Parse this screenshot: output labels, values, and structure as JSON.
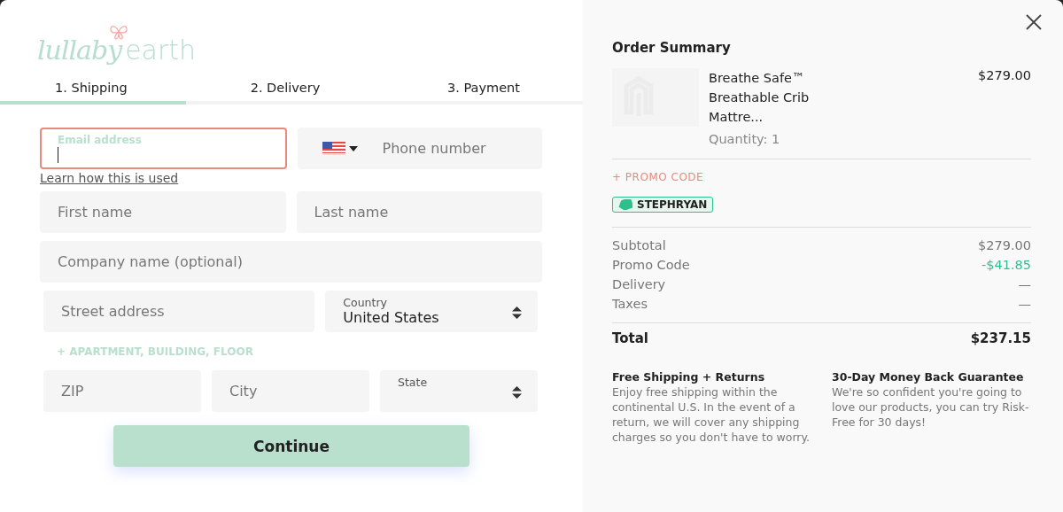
{
  "logo": {
    "text_1": "lullaby",
    "text_2": "earth"
  },
  "steps": [
    {
      "label": "1. Shipping",
      "selected": true
    },
    {
      "label": "2. Delivery",
      "selected": false
    },
    {
      "label": "3. Payment",
      "selected": false
    }
  ],
  "form": {
    "rows": [
      [
        {
          "kind": "input",
          "label": "Email address",
          "error": true,
          "focused": true
        },
        {
          "kind": "phone",
          "placeholder": "Phone number"
        }
      ],
      [
        {
          "kind": "link",
          "text": "Learn how this is used"
        }
      ],
      [
        {
          "kind": "input",
          "placeholder": "First name"
        },
        {
          "kind": "input",
          "placeholder": "Last name"
        }
      ],
      [
        {
          "kind": "input",
          "placeholder": "Company name (optional)"
        }
      ],
      [
        {
          "kind": "input",
          "placeholder": "Street address"
        },
        {
          "kind": "select",
          "label": "Country",
          "value": "United States"
        }
      ],
      [
        {
          "kind": "addlink",
          "text": "+ APARTMENT, BUILDING, FLOOR"
        }
      ],
      [
        {
          "kind": "input",
          "placeholder": "ZIP"
        },
        {
          "kind": "input",
          "placeholder": "City"
        },
        {
          "kind": "select",
          "label": "State"
        }
      ]
    ],
    "submit": "Continue"
  },
  "summary": {
    "title": "Order Summary",
    "item": {
      "name": "Breathe Safe™ Breathable Crib Mattre...",
      "price": "$279.00",
      "quantity": "Quantity: 1"
    },
    "promo_link": "+ PROMO CODE",
    "promo_tag": "STEPHRYAN",
    "lines": [
      {
        "label": "Subtotal",
        "value": "$279.00",
        "kind": "plain"
      },
      {
        "label": "Promo Code",
        "value": "-$41.85",
        "kind": "discount"
      },
      {
        "label": "Delivery",
        "value": "—",
        "kind": "plain"
      },
      {
        "label": "Taxes",
        "value": "—",
        "kind": "plain"
      }
    ],
    "total": {
      "label": "Total",
      "value": "$237.15"
    },
    "notes": [
      {
        "title": "Free Shipping + Returns",
        "text": "Enjoy free shipping within the continental U.S. In the event of a return, we will cover any shipping charges so you don't have to worry."
      },
      {
        "title": "30-Day Money Back Guarantee",
        "text": "We're so confident you're going to love our products, you can try Risk-Free for 30 days!"
      }
    ]
  }
}
